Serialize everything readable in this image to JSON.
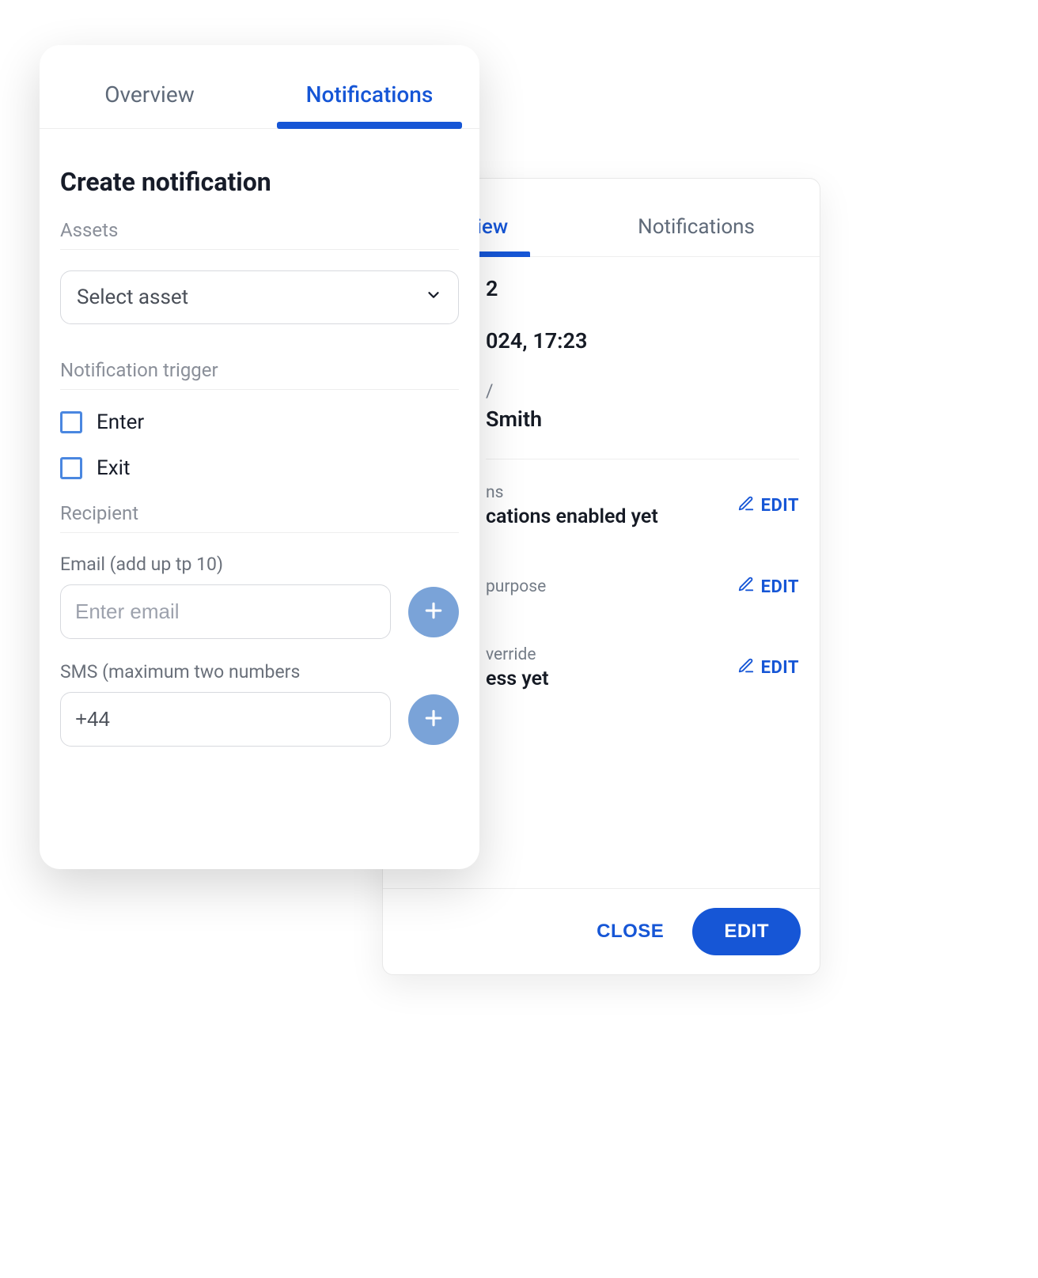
{
  "colors": {
    "accent": "#1656d6",
    "muted": "#8a8f99"
  },
  "front": {
    "tabs": {
      "overview": "Overview",
      "notifications": "Notifications",
      "active_index": 1
    },
    "title": "Create notification",
    "sections": {
      "assets_label": "Assets",
      "select_placeholder": "Select asset",
      "trigger_label": "Notification trigger",
      "trigger_options": {
        "enter": "Enter",
        "exit": "Exit"
      },
      "recipient_label": "Recipient",
      "email_label": "Email (add up tp 10)",
      "email_placeholder": "Enter email",
      "sms_label": "SMS (maximum two numbers",
      "sms_prefix": "+44"
    },
    "icons": {
      "chevron_down": "chevron-down-icon",
      "plus": "plus-icon"
    }
  },
  "back": {
    "tabs": {
      "overview_fragment": "erview",
      "notifications": "Notifications",
      "active_index": 0
    },
    "rows": {
      "r1_value_fragment": "2",
      "r2_value_fragment": "024, 17:23",
      "r3_label_fragment": "/",
      "r3_value_fragment": "Smith"
    },
    "items": {
      "i1_label_fragment": "ns",
      "i1_value_fragment": "cations enabled yet",
      "i2_label_fragment": "purpose",
      "i3_label_fragment": "verride",
      "i3_value_fragment": "ess yet"
    },
    "edit_action": "EDIT",
    "footer": {
      "close": "CLOSE",
      "edit": "EDIT"
    },
    "icons": {
      "pencil": "pencil-icon"
    }
  }
}
